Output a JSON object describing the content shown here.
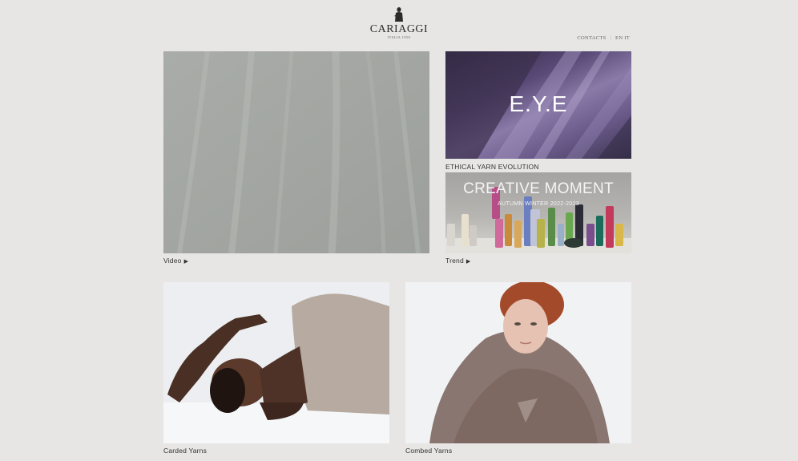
{
  "brand": {
    "name": "CARIAGGI",
    "tagline": "ITALIA 1958"
  },
  "topnav": {
    "contacts": "CONTACTS",
    "lang_en": "EN",
    "lang_it": "IT"
  },
  "tiles": {
    "video": {
      "caption": "Video",
      "arrow": "▶"
    },
    "eye": {
      "title": "E.Y.E",
      "caption": "ETHICAL YARN EVOLUTION"
    },
    "trend": {
      "title": "CREATIVE MOMENT",
      "subtitle": "AUTUMN WINTER 2022-2023",
      "caption": "Trend",
      "arrow": "▶"
    },
    "carded": {
      "caption": "Carded Yarns"
    },
    "combed": {
      "caption": "Combed Yarns"
    }
  },
  "icons": {
    "logo_mark": "statue-icon",
    "play": "play-arrow-icon"
  },
  "colors": {
    "background": "#e7e6e4",
    "text": "#333333",
    "eye_purple": "#6a5a8a"
  }
}
